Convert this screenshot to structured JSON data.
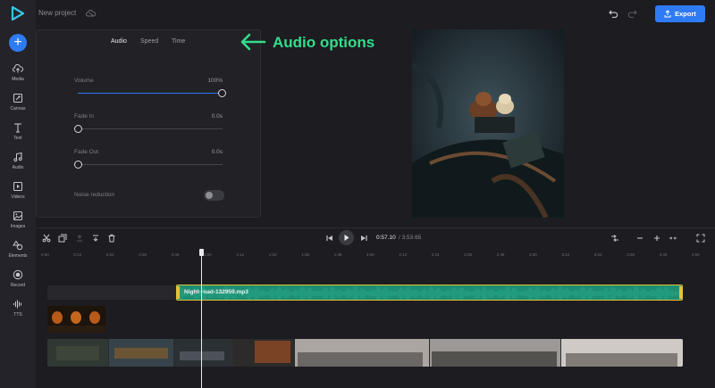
{
  "app": {
    "project_name": "New project",
    "export_label": "Export",
    "accent": "#2e7bf5"
  },
  "sidebar": {
    "items": [
      {
        "label": "Media",
        "icon": "cloud-upload-icon"
      },
      {
        "label": "Canvas",
        "icon": "canvas-icon"
      },
      {
        "label": "Text",
        "icon": "text-icon"
      },
      {
        "label": "Audio",
        "icon": "music-note-icon"
      },
      {
        "label": "Videos",
        "icon": "video-icon"
      },
      {
        "label": "Images",
        "icon": "image-icon"
      },
      {
        "label": "Elements",
        "icon": "shapes-icon"
      },
      {
        "label": "Record",
        "icon": "record-icon"
      },
      {
        "label": "TTS",
        "icon": "waveform-icon"
      }
    ]
  },
  "panel": {
    "tabs": [
      "Audio",
      "Speed",
      "Time"
    ],
    "active_tab": "Audio",
    "volume": {
      "label": "Volume",
      "value": "100%",
      "level": 1.0
    },
    "fade_in": {
      "label": "Fade In",
      "value": "0.0s",
      "level": 0
    },
    "fade_out": {
      "label": "Fade Out",
      "value": "0.0s",
      "level": 0
    },
    "noise": {
      "label": "Noise reduction",
      "enabled": false
    }
  },
  "annotation": {
    "text": "Audio options",
    "color": "#33dd8a"
  },
  "timeline": {
    "current_time": "0:57.10",
    "total_time": "/ 3:53.65",
    "ruler": [
      "0:00",
      "0:12",
      "0:24",
      "0:36",
      "0:48",
      "1:00",
      "1:12",
      "1:24",
      "1:36",
      "1:48",
      "2:00",
      "2:12",
      "2:24",
      "2:36",
      "2:48",
      "3:00",
      "3:12",
      "3:24",
      "3:36",
      "3:48",
      "4:00"
    ],
    "audio_clip_name": "Night-road-132959.mp3",
    "audio_clip_color": "#1d8e73",
    "selected_border": "#e3c33a"
  }
}
